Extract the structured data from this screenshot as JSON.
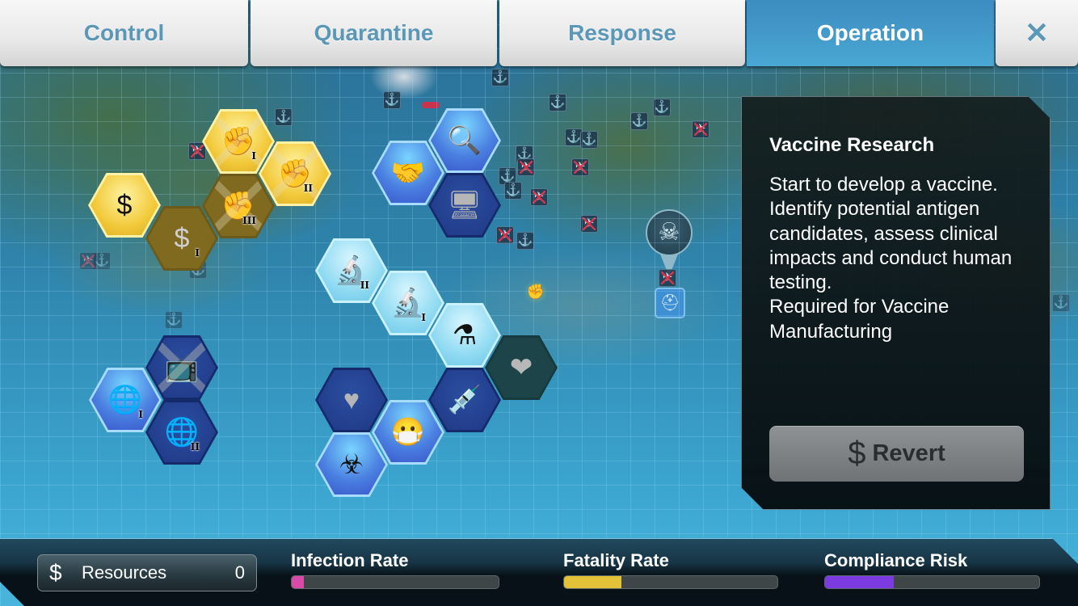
{
  "tabs": [
    {
      "label": "Control",
      "active": false
    },
    {
      "label": "Quarantine",
      "active": false
    },
    {
      "label": "Response",
      "active": false
    },
    {
      "label": "Operation",
      "active": true
    }
  ],
  "close_label": "✕",
  "map": {
    "icons": {
      "anchor": "⚓",
      "airport": "✈",
      "skull": "☠",
      "fist": "✊",
      "gas_mask": "⛑"
    }
  },
  "upgrades": [
    {
      "id": "funding-1",
      "icon": "hand-dollar-icon",
      "glyph": "$",
      "tier": "",
      "style": "gold"
    },
    {
      "id": "funding-2",
      "icon": "hand-dollar-icon",
      "glyph": "$",
      "tier": "I",
      "style": "olive"
    },
    {
      "id": "riot-control-1",
      "icon": "fist-icon",
      "glyph": "✊",
      "tier": "I",
      "style": "gold",
      "crossed": true
    },
    {
      "id": "riot-control-2",
      "icon": "fist-icon",
      "glyph": "✊",
      "tier": "II",
      "style": "gold",
      "crossed": true
    },
    {
      "id": "riot-control-3",
      "icon": "fist-icon",
      "glyph": "✊",
      "tier": "III",
      "style": "olive",
      "crossed": true
    },
    {
      "id": "cooperation",
      "icon": "handshake-icon",
      "glyph": "🤝",
      "tier": "",
      "style": "blue"
    },
    {
      "id": "surveillance",
      "icon": "magnifier-icon",
      "glyph": "🔍",
      "tier": "",
      "style": "blue"
    },
    {
      "id": "computer-model",
      "icon": "computer-icon",
      "glyph": "🖥",
      "tier": "",
      "style": "navy"
    },
    {
      "id": "vaccine-research-2",
      "icon": "microscope-icon",
      "glyph": "🔬",
      "tier": "II",
      "style": "lightblue"
    },
    {
      "id": "vaccine-research-1",
      "icon": "microscope-icon",
      "glyph": "🔬",
      "tier": "I",
      "style": "lightblue",
      "selected": true
    },
    {
      "id": "lab-process",
      "icon": "flask-gear-icon",
      "glyph": "⚗",
      "tier": "",
      "style": "lightblue"
    },
    {
      "id": "vaccine-care",
      "icon": "heart-syringe-icon",
      "glyph": "❤",
      "tier": "",
      "style": "darkteal"
    },
    {
      "id": "vaccination",
      "icon": "syringe-icon",
      "glyph": "💉",
      "tier": "",
      "style": "navy"
    },
    {
      "id": "heart-monitor",
      "icon": "heart-pulse-icon",
      "glyph": "♥",
      "tier": "",
      "style": "navy"
    },
    {
      "id": "gas-mask",
      "icon": "gas-mask-icon",
      "glyph": "😷",
      "tier": "",
      "style": "blue"
    },
    {
      "id": "biohazard",
      "icon": "biohazard-icon",
      "glyph": "☣",
      "tier": "",
      "style": "blue"
    },
    {
      "id": "media-blackout",
      "icon": "tv-icon",
      "glyph": "📺",
      "tier": "",
      "style": "navy",
      "crossed": true
    },
    {
      "id": "global-cooperation-1",
      "icon": "globe-laurel-icon",
      "glyph": "🌐",
      "tier": "I",
      "style": "blue"
    },
    {
      "id": "global-cooperation-2",
      "icon": "globe-laurel-icon",
      "glyph": "🌐",
      "tier": "II",
      "style": "navy"
    }
  ],
  "info_panel": {
    "title": "Vaccine Research",
    "description": "Start to develop a vaccine.\nIdentify potential antigen candidates, assess clinical impacts and conduct human testing.\nRequired for Vaccine Manufacturing",
    "revert_symbol": "$",
    "revert_label": "Revert"
  },
  "bottom_bar": {
    "resources": {
      "symbol": "$",
      "label": "Resources",
      "value": "0"
    },
    "stats": [
      {
        "label": "Infection Rate",
        "percent": 6,
        "color": "#d94aa8"
      },
      {
        "label": "Fatality Rate",
        "percent": 27,
        "color": "#e3c23a"
      },
      {
        "label": "Compliance Risk",
        "percent": 32,
        "color": "#7b3be0"
      }
    ]
  }
}
